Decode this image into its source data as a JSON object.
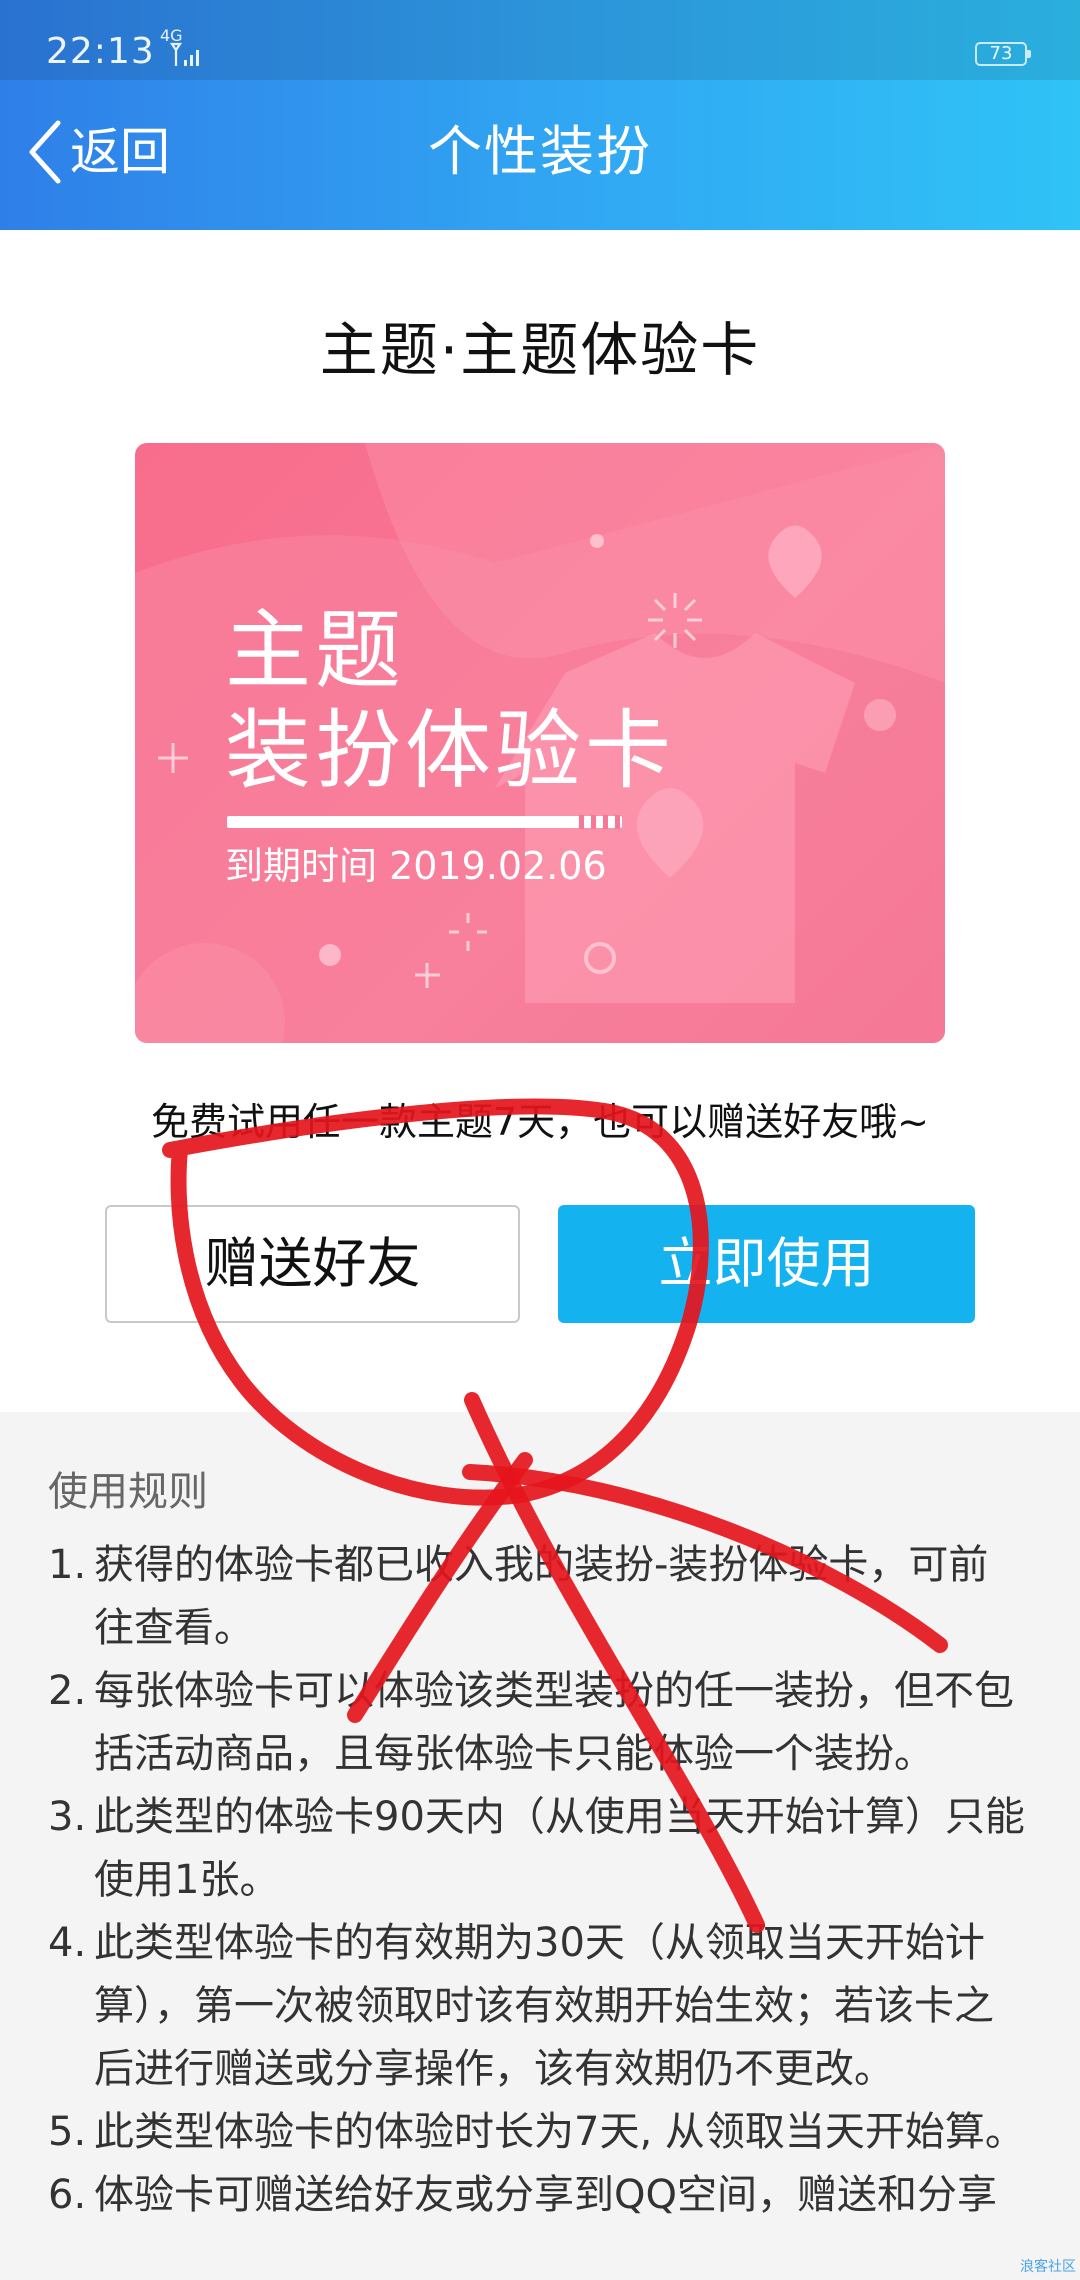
{
  "status_bar": {
    "time": "22:13",
    "network": "4G",
    "battery": "73"
  },
  "nav": {
    "back_label": "返回",
    "title": "个性装扮"
  },
  "card": {
    "title": "主题·主题体验卡",
    "image_line1": "主题",
    "image_line2": "装扮体验卡",
    "expiry": "到期时间 2019.02.06"
  },
  "description": "免费试用任一款主题7天，也可以赠送好友哦~",
  "buttons": {
    "gift": "赠送好友",
    "use": "立即使用"
  },
  "rules": {
    "title": "使用规则",
    "items": [
      {
        "num": "1.",
        "text": "获得的体验卡都已收入我的装扮-装扮体验卡，可前往查看。"
      },
      {
        "num": "2.",
        "text": "每张体验卡可以体验该类型装扮的任一装扮，但不包括活动商品，且每张体验卡只能体验一个装扮。"
      },
      {
        "num": "3.",
        "text": "此类型的体验卡90天内（从使用当天开始计算）只能使用1张。"
      },
      {
        "num": "4.",
        "text": "此类型体验卡的有效期为30天（从领取当天开始计算），第一次被领取时该有效期开始生效；若该卡之后进行赠送或分享操作，该有效期仍不更改。"
      },
      {
        "num": "5.",
        "text": "此类型体验卡的体验时长为7天, 从领取当天开始算。"
      },
      {
        "num": "6.",
        "text": "体验卡可赠送给好友或分享到QQ空间，赠送和分享"
      }
    ]
  },
  "watermark": "浪客社区",
  "colors": {
    "header_start": "#2f7fe8",
    "header_end": "#2fc3f6",
    "card_pink": "#f77896",
    "use_button": "#14b2ef",
    "scribble_red": "#e5151c"
  }
}
